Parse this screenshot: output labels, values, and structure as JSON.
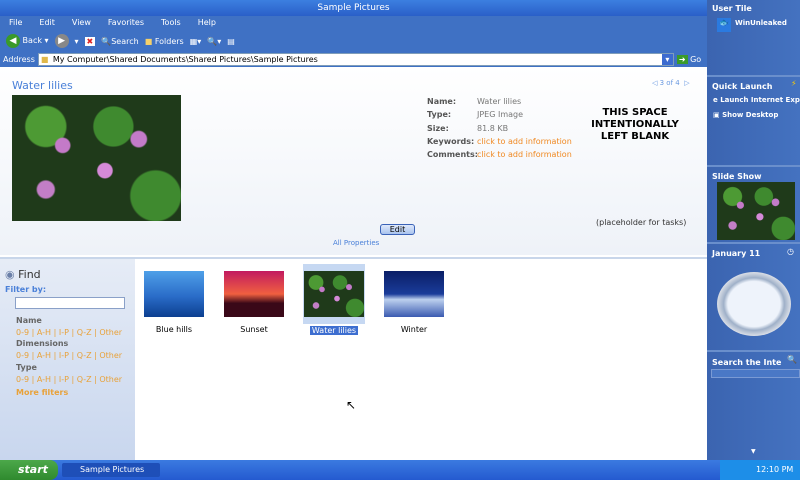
{
  "window": {
    "title": "Sample Pictures"
  },
  "menu": [
    "File",
    "Edit",
    "View",
    "Favorites",
    "Tools",
    "Help"
  ],
  "toolbar": {
    "back": "Back",
    "search": "Search",
    "folders": "Folders"
  },
  "address": {
    "label": "Address",
    "value": "My Computer\\Shared Documents\\Shared Pictures\\Sample Pictures",
    "go": "Go"
  },
  "preview": {
    "title": "Water lilies",
    "pager": "3 of 4",
    "edit": "Edit",
    "all_properties": "All Properties",
    "props": [
      {
        "k": "Name:",
        "v": "Water lilies"
      },
      {
        "k": "Type:",
        "v": "JPEG Image"
      },
      {
        "k": "Size:",
        "v": "81.8 KB"
      },
      {
        "k": "Keywords:",
        "v": "click to add information"
      },
      {
        "k": "Comments:",
        "v": "click to add information"
      }
    ],
    "blank": "THIS SPACE INTENTIONALLY LEFT BLANK",
    "placeholder": "(placeholder for tasks)"
  },
  "find": {
    "title": "Find",
    "filter_by": "Filter by:",
    "groups": [
      "Name",
      "Dimensions",
      "Type"
    ],
    "links": [
      "0-9",
      "A-H",
      "I-P",
      "Q-Z",
      "Other"
    ],
    "more": "More filters"
  },
  "thumbs": [
    {
      "name": "Blue hills"
    },
    {
      "name": "Sunset"
    },
    {
      "name": "Water lilies",
      "selected": true
    },
    {
      "name": "Winter"
    }
  ],
  "sidebar": {
    "user_tile": "User Tile",
    "user": "WinUnleaked",
    "quick_launch": "Quick Launch",
    "ql_items": [
      "Launch Internet Explorer",
      "Show Desktop"
    ],
    "slide_show": "Slide Show",
    "date": "January 11",
    "search": "Search the Internet"
  },
  "taskbar": {
    "start": "start",
    "task": "Sample Pictures",
    "time": "12:10 PM"
  }
}
